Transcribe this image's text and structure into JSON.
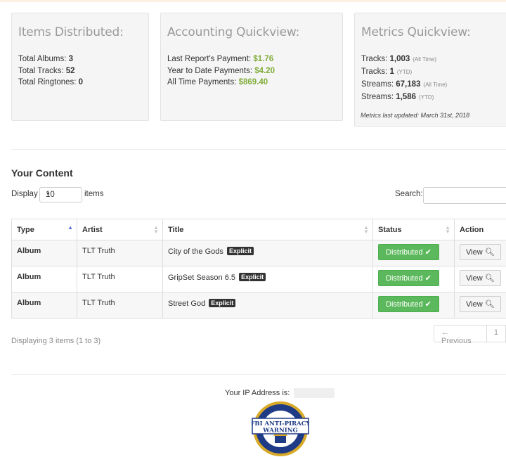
{
  "panels": {
    "items": {
      "title": "Items Distributed:",
      "rows": [
        {
          "label": "Total Albums:",
          "value": "3"
        },
        {
          "label": "Total Tracks:",
          "value": "52"
        },
        {
          "label": "Total Ringtones:",
          "value": "0"
        }
      ]
    },
    "accounting": {
      "title": "Accounting Quickview:",
      "rows": [
        {
          "label": "Last Report's Payment:",
          "value": "$1.76"
        },
        {
          "label": "Year to Date Payments:",
          "value": "$4.20"
        },
        {
          "label": "All Time Payments:",
          "value": "$869.40"
        }
      ]
    },
    "metrics": {
      "title": "Metrics Quickview:",
      "rows": [
        {
          "label": "Tracks:",
          "value": "1,003",
          "scope": "(All Time)"
        },
        {
          "label": "Tracks:",
          "value": "1",
          "scope": "(YTD)"
        },
        {
          "label": "Streams:",
          "value": "67,183",
          "scope": "(All Time)"
        },
        {
          "label": "Streams:",
          "value": "1,586",
          "scope": "(YTD)"
        }
      ],
      "note": "Metrics last updated: March 31st, 2018"
    }
  },
  "content": {
    "title": "Your Content",
    "display_label": "Display",
    "page_size": "10",
    "items_label": "items",
    "search_label": "Search:",
    "search_value": "",
    "columns": [
      "Type",
      "Artist",
      "Title",
      "Status",
      "Action"
    ],
    "rows": [
      {
        "type": "Album",
        "artist": "TLT Truth",
        "title": "City of the Gods",
        "badge": "Explicit",
        "status": "Distributed",
        "action": "View"
      },
      {
        "type": "Album",
        "artist": "TLT Truth",
        "title": "GripSet Season 6.5",
        "badge": "Explicit",
        "status": "Distributed",
        "action": "View"
      },
      {
        "type": "Album",
        "artist": "TLT Truth",
        "title": "Street God",
        "badge": "Explicit",
        "status": "Distributed",
        "action": "View"
      }
    ],
    "footer": "Displaying 3 items (1 to 3)",
    "pager": {
      "previous": "← Previous",
      "page": "1"
    }
  },
  "footer": {
    "ip_label": "Your IP Address is:",
    "seal": {
      "line1": "FBI ANTI-PIRACY",
      "line2": "WARNING"
    }
  },
  "colors": {
    "accent_green": "#5cb85c",
    "money_green": "#7fad39",
    "panel_bg": "#f5f5f5"
  }
}
